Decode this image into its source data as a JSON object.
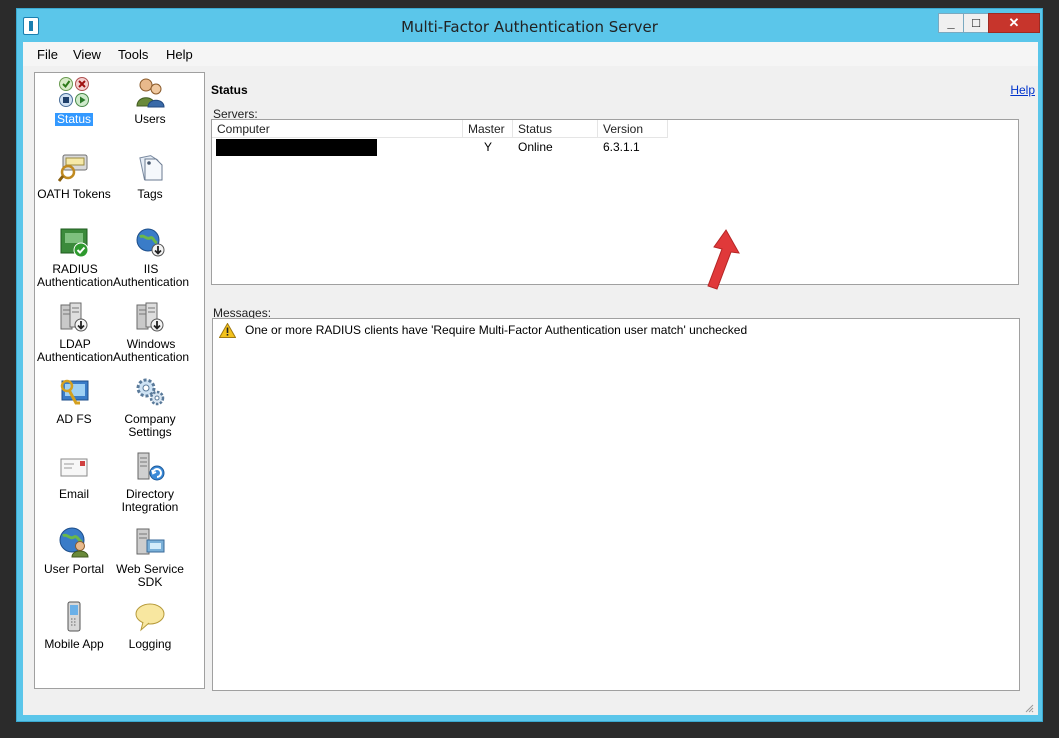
{
  "window": {
    "title": "Multi-Factor Authentication Server",
    "minimize_glyph": "_",
    "maximize_glyph": "□",
    "close_glyph": "✕"
  },
  "menu": [
    "File",
    "View",
    "Tools",
    "Help"
  ],
  "sidebar": {
    "items": [
      {
        "label": "Status",
        "icon": "status-icon",
        "selected": true
      },
      {
        "label": "Users",
        "icon": "users-icon"
      },
      {
        "label": "OATH Tokens",
        "icon": "oath-tokens-icon"
      },
      {
        "label": "Tags",
        "icon": "tags-icon"
      },
      {
        "label": "RADIUS\nAuthentication",
        "icon": "radius-icon"
      },
      {
        "label": "IIS\nAuthentication",
        "icon": "iis-icon"
      },
      {
        "label": "LDAP\nAuthentication",
        "icon": "ldap-icon"
      },
      {
        "label": "Windows\nAuthentication",
        "icon": "windows-auth-icon"
      },
      {
        "label": "AD FS",
        "icon": "adfs-icon"
      },
      {
        "label": "Company\nSettings",
        "icon": "company-settings-icon"
      },
      {
        "label": "Email",
        "icon": "email-icon"
      },
      {
        "label": "Directory\nIntegration",
        "icon": "directory-integration-icon"
      },
      {
        "label": "User Portal",
        "icon": "user-portal-icon"
      },
      {
        "label": "Web Service\nSDK",
        "icon": "web-service-sdk-icon"
      },
      {
        "label": "Mobile App",
        "icon": "mobile-app-icon"
      },
      {
        "label": "Logging",
        "icon": "logging-icon"
      }
    ]
  },
  "main": {
    "heading": "Status",
    "help_link": "Help",
    "servers_label": "Servers:",
    "servers_columns": [
      "Computer",
      "Master",
      "Status",
      "Version"
    ],
    "servers_rows": [
      {
        "computer": "",
        "master": "Y",
        "status": "Online",
        "version": "6.3.1.1"
      }
    ],
    "messages_label": "Messages:",
    "messages": [
      {
        "icon": "warning-icon",
        "text": "One or more RADIUS clients have 'Require Multi-Factor Authentication user match' unchecked"
      }
    ]
  },
  "colors": {
    "title_bar": "#5bc6ea",
    "close_button": "#c7352c",
    "selection": "#3399ff",
    "annotation_arrow": "#e0393a"
  }
}
